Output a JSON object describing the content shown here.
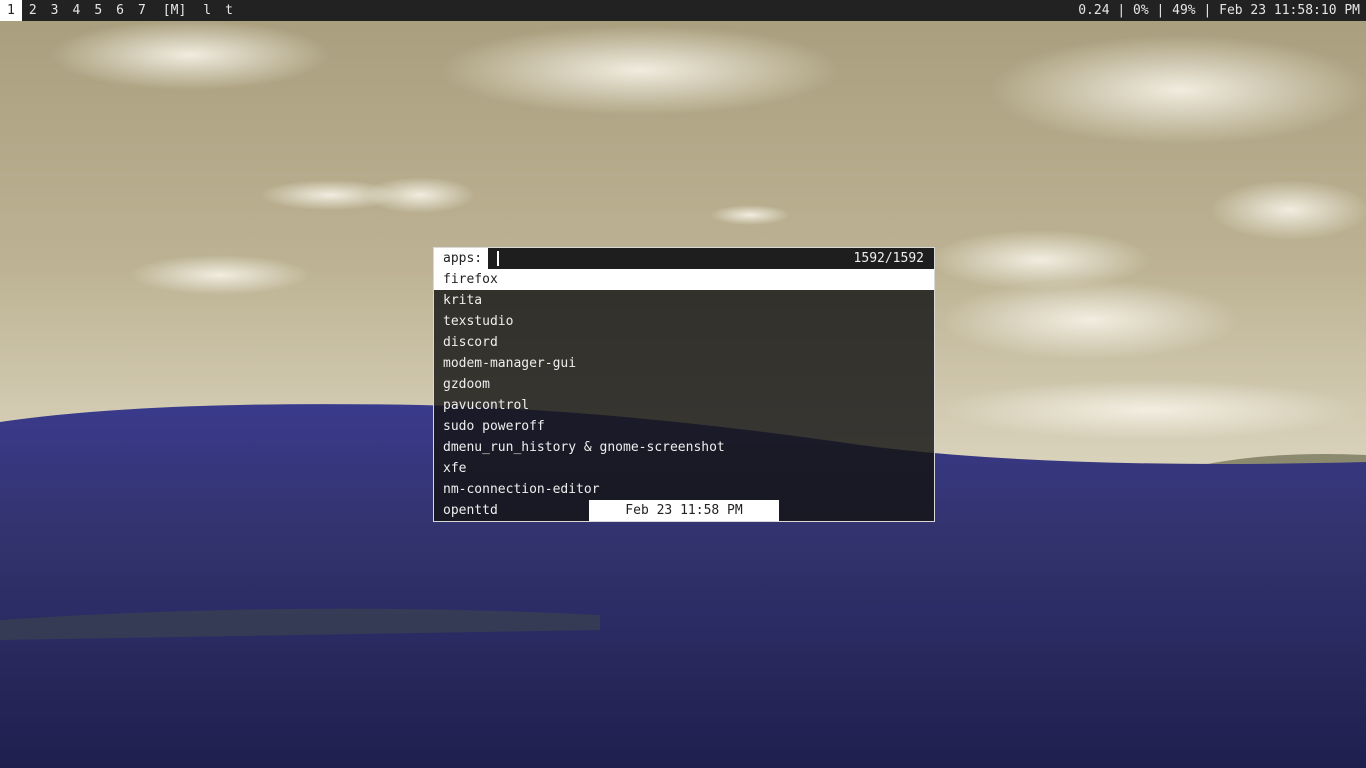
{
  "topbar": {
    "tags": [
      "1",
      "2",
      "3",
      "4",
      "5",
      "6",
      "7"
    ],
    "active_tag": "1",
    "layout_symbol": "[M]",
    "extra": [
      "l",
      "t"
    ],
    "status": "0.24 | 0% | 49% | Feb 23 11:58:10 PM"
  },
  "launcher": {
    "prompt": "apps:",
    "input_value": "",
    "count": "1592/1592",
    "items": [
      "firefox",
      "krita",
      "texstudio",
      "discord",
      "modem-manager-gui",
      "gzdoom",
      "pavucontrol",
      "sudo poweroff",
      "dmenu_run_history & gnome-screenshot",
      "xfe",
      "nm-connection-editor",
      "openttd"
    ],
    "selected_index": 0
  },
  "notification": {
    "clock": "Feb 23 11:58 PM"
  },
  "colors": {
    "bar_bg": "#222222",
    "bar_fg": "#e6e6e6",
    "selected_bg": "#ffffff",
    "hill": "#2f2f78"
  }
}
